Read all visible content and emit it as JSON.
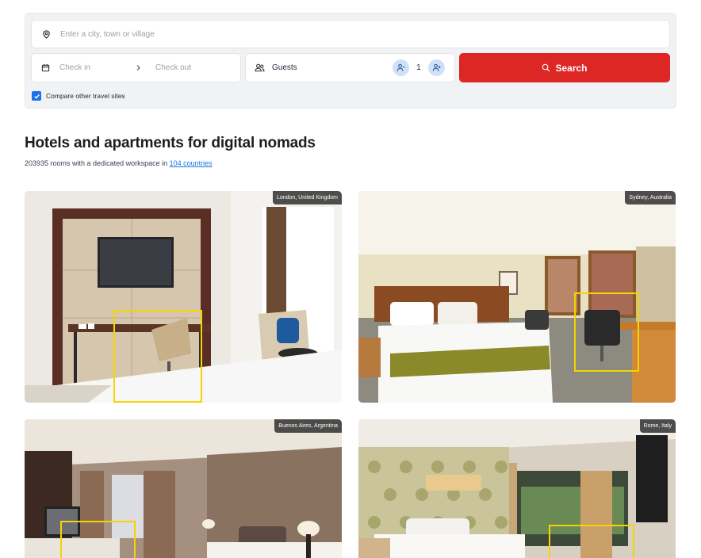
{
  "search": {
    "location_placeholder": "Enter a city, town or village",
    "checkin_placeholder": "Check in",
    "checkout_placeholder": "Check out",
    "guests_label": "Guests",
    "guests_count": "1",
    "search_label": "Search",
    "compare_label": "Compare other travel sites",
    "compare_checked": true
  },
  "section": {
    "title": "Hotels and apartments for digital nomads",
    "subtitle_prefix": "203935 rooms with a dedicated workspace in ",
    "subtitle_link": "104 countries"
  },
  "hotels": [
    {
      "city": "London, United Kingdom"
    },
    {
      "city": "Sydney, Australia"
    },
    {
      "city": "Buenos Aires, Argentina"
    },
    {
      "city": "Rome, Italy"
    }
  ],
  "colors": {
    "accent_red": "#dd2724",
    "link_blue": "#1a73e8",
    "highlight_yellow": "#f5d400"
  },
  "icons": {
    "location": "map-pin-icon",
    "calendar": "calendar-icon",
    "chevron": "chevron-right-icon",
    "guests": "users-icon",
    "stepper": "user-stepper-icon",
    "search": "search-icon",
    "check": "check-icon"
  }
}
